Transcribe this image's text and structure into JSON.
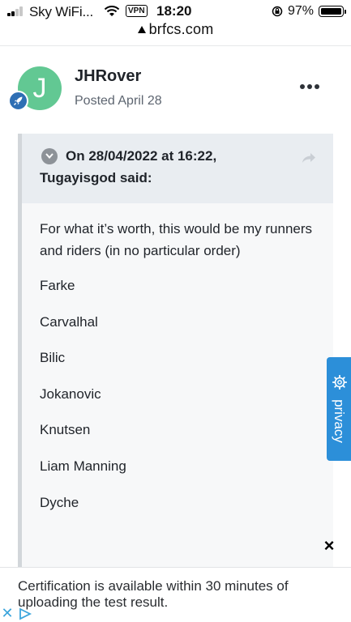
{
  "status_bar": {
    "carrier": "Sky WiFi...",
    "vpn": "VPN",
    "time": "18:20",
    "battery": "97%",
    "battery_level": 0.97
  },
  "browser": {
    "url": "brfcs.com"
  },
  "post": {
    "avatar_letter": "J",
    "author": "JHRover",
    "date": "Posted April 28",
    "avatar_color": "#62c893",
    "badge_icon": "rocket-icon"
  },
  "quote": {
    "attribution_line1": "On 28/04/2022 at 16:22,",
    "attribution_line2": "Tugayisgod said:",
    "intro": "For what it’s worth, this would be my runners and riders (in no particular order)",
    "names": [
      "Farke",
      "Carvalhal",
      "Bilic",
      "Jokanovic",
      "Knutsen",
      "Liam Manning",
      "Dyche"
    ]
  },
  "privacy": {
    "label": "privacy",
    "icon": "gear-icon",
    "color": "#2c8fd9"
  },
  "ad": {
    "close": "×",
    "text": "Certification is available within 30 minutes of uploading the test result."
  }
}
